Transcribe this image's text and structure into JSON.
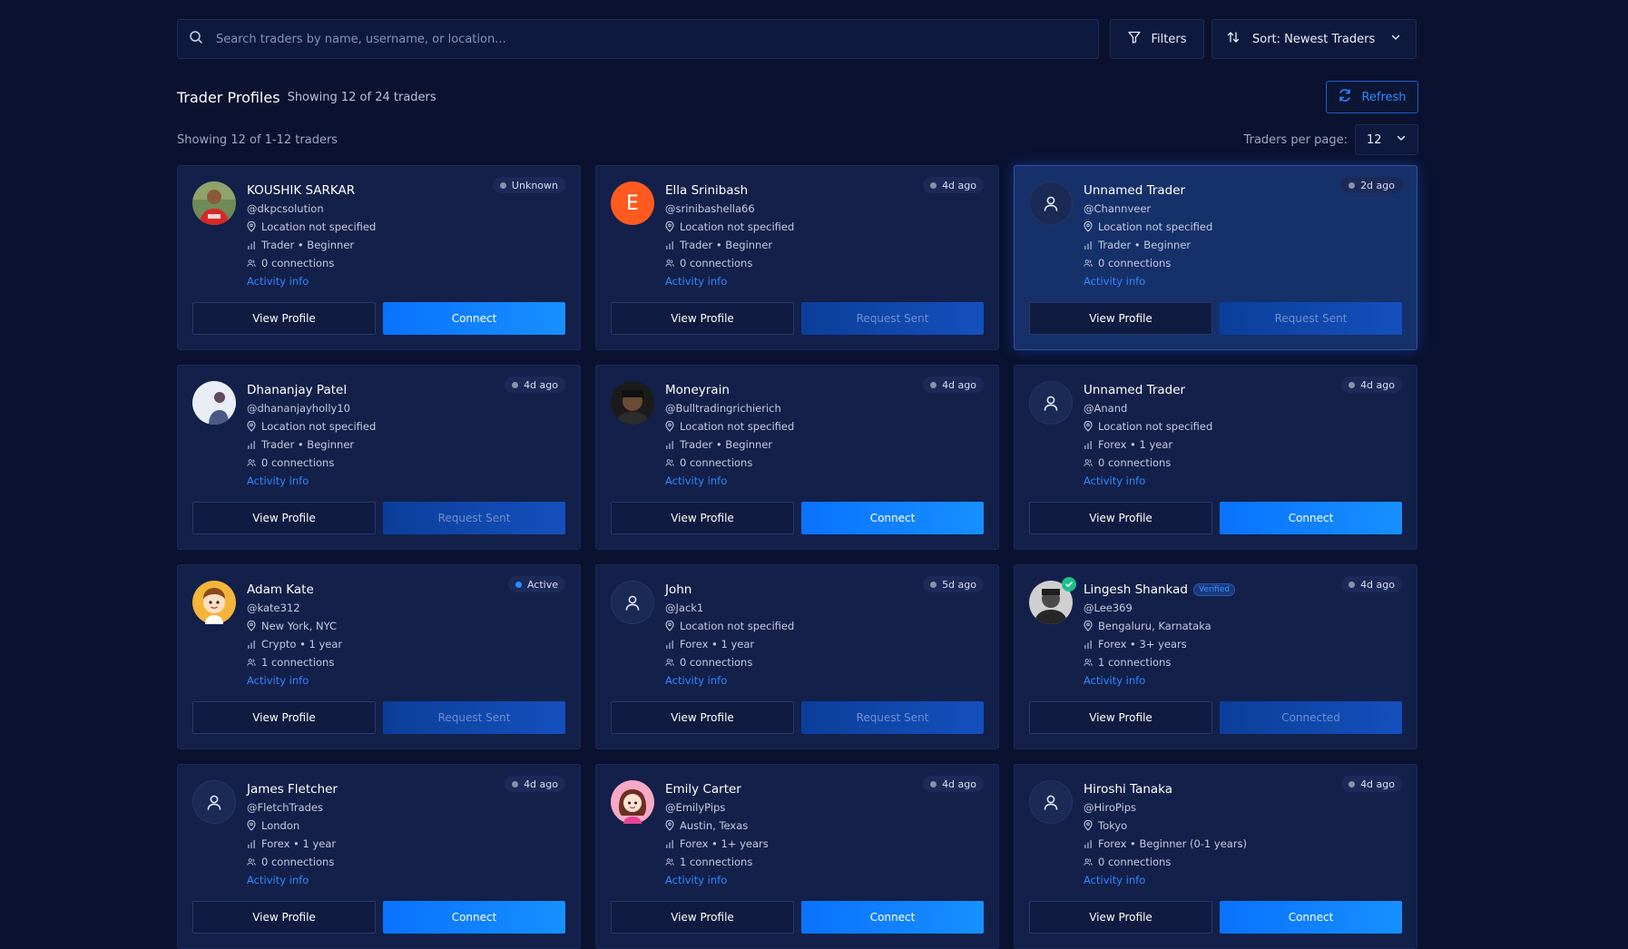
{
  "search": {
    "placeholder": "Search traders by name, username, or location..."
  },
  "toolbar": {
    "filters_label": "Filters",
    "sort_label": "Sort: Newest Traders"
  },
  "header": {
    "title": "Trader Profiles",
    "subtitle": "Showing 12 of 24 traders",
    "refresh_label": "Refresh"
  },
  "meta": {
    "showing": "Showing 12 of 1-12 traders",
    "per_page_label": "Traders per page:",
    "per_page_value": "12"
  },
  "colors": {
    "accent": "#1690ff",
    "background": "#0a1230",
    "card": "#13204a",
    "verified": "#19c08a"
  },
  "cards": [
    {
      "name": "KOUSHIK SARKAR",
      "handle": "@dkpcsolution",
      "location": "Location not specified",
      "role": "Trader • Beginner",
      "connections": "0 connections",
      "activity": "Activity info",
      "badge": "Unknown",
      "badge_state": "inactive",
      "avatar": "photo-red",
      "view": "View Profile",
      "action": "Connect",
      "action_state": "connect",
      "highlight": false
    },
    {
      "name": "Ella Srinibash",
      "handle": "@srinibashella66",
      "location": "Location not specified",
      "role": "Trader • Beginner",
      "connections": "0 connections",
      "activity": "Activity info",
      "badge": "4d ago",
      "badge_state": "inactive",
      "avatar": "letter",
      "avatar_letter": "E",
      "view": "View Profile",
      "action": "Request Sent",
      "action_state": "sent",
      "highlight": false
    },
    {
      "name": "Unnamed Trader",
      "handle": "@Channveer",
      "location": "Location not specified",
      "role": "Trader • Beginner",
      "connections": "0 connections",
      "activity": "Activity info",
      "badge": "2d ago",
      "badge_state": "inactive",
      "avatar": "generic",
      "view": "View Profile",
      "action": "Request Sent",
      "action_state": "sent",
      "highlight": true
    },
    {
      "name": "Dhananjay Patel",
      "handle": "@dhananjayholly10",
      "location": "Location not specified",
      "role": "Trader • Beginner",
      "connections": "0 connections",
      "activity": "Activity info",
      "badge": "4d ago",
      "badge_state": "inactive",
      "avatar": "photo-light",
      "view": "View Profile",
      "action": "Request Sent",
      "action_state": "sent",
      "highlight": false
    },
    {
      "name": "Moneyrain",
      "handle": "@Bulltradingrichierich",
      "location": "Location not specified",
      "role": "Trader • Beginner",
      "connections": "0 connections",
      "activity": "Activity info",
      "badge": "4d ago",
      "badge_state": "inactive",
      "avatar": "photo-dark",
      "view": "View Profile",
      "action": "Connect",
      "action_state": "connect",
      "highlight": false
    },
    {
      "name": "Unnamed Trader",
      "handle": "@Anand",
      "location": "Location not specified",
      "role": "Forex • 1 year",
      "connections": "0 connections",
      "activity": "Activity info",
      "badge": "4d ago",
      "badge_state": "inactive",
      "avatar": "generic",
      "view": "View Profile",
      "action": "Connect",
      "action_state": "connect",
      "highlight": false
    },
    {
      "name": "Adam Kate",
      "handle": "@kate312",
      "location": "New York, NYC",
      "role": "Crypto • 1 year",
      "connections": "1 connections",
      "activity": "Activity info",
      "badge": "Active",
      "badge_state": "active",
      "avatar": "cartoon-boy",
      "view": "View Profile",
      "action": "Request Sent",
      "action_state": "sent",
      "highlight": false
    },
    {
      "name": "John",
      "handle": "@Jack1",
      "location": "Location not specified",
      "role": "Forex • 1 year",
      "connections": "0 connections",
      "activity": "Activity info",
      "badge": "5d ago",
      "badge_state": "inactive",
      "avatar": "generic",
      "view": "View Profile",
      "action": "Request Sent",
      "action_state": "sent",
      "highlight": false
    },
    {
      "name": "Lingesh Shankad",
      "verified_label": "Verified",
      "handle": "@Lee369",
      "location": "Bengaluru, Karnataka",
      "role": "Forex • 3+ years",
      "connections": "1 connections",
      "activity": "Activity info",
      "badge": "4d ago",
      "badge_state": "inactive",
      "avatar": "photo-bw",
      "view": "View Profile",
      "action": "Connected",
      "action_state": "sent",
      "highlight": false
    },
    {
      "name": "James Fletcher",
      "handle": "@FletchTrades",
      "location": "London",
      "role": "Forex • 1 year",
      "connections": "0 connections",
      "activity": "Activity info",
      "badge": "4d ago",
      "badge_state": "inactive",
      "avatar": "generic",
      "view": "View Profile",
      "action": "Connect",
      "action_state": "connect",
      "highlight": false
    },
    {
      "name": "Emily Carter",
      "handle": "@EmilyPips",
      "location": "Austin, Texas",
      "role": "Forex • 1+ years",
      "connections": "1 connections",
      "activity": "Activity info",
      "badge": "4d ago",
      "badge_state": "inactive",
      "avatar": "cartoon-girl",
      "view": "View Profile",
      "action": "Connect",
      "action_state": "connect",
      "highlight": false
    },
    {
      "name": "Hiroshi Tanaka",
      "handle": "@HiroPips",
      "location": "Tokyo",
      "role": "Forex • Beginner (0-1 years)",
      "connections": "0 connections",
      "activity": "Activity info",
      "badge": "4d ago",
      "badge_state": "inactive",
      "avatar": "generic",
      "view": "View Profile",
      "action": "Connect",
      "action_state": "connect",
      "highlight": false
    }
  ]
}
